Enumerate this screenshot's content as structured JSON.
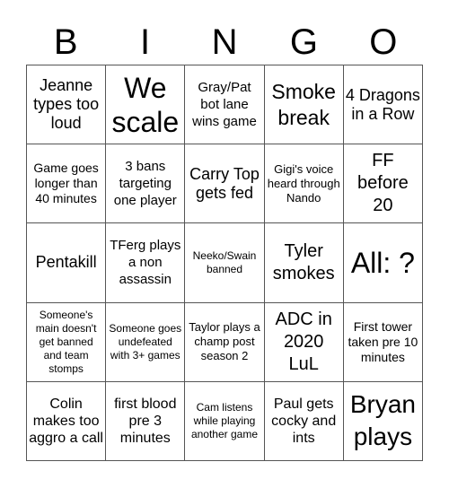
{
  "header": {
    "letters": [
      "B",
      "I",
      "N",
      "G",
      "O"
    ]
  },
  "cells": [
    [
      "Jeanne types too loud",
      "We scale",
      "Gray/Pat bot lane wins game",
      "Smoke break",
      "4 Dragons in a Row"
    ],
    [
      "Game goes longer than 40 minutes",
      "3 bans targeting one player",
      "Carry Top gets fed",
      "Gigi's voice heard through Nando",
      "FF before 20"
    ],
    [
      "Pentakill",
      "TFerg plays a non assassin",
      "Neeko/Swain banned",
      "Tyler smokes",
      "All: ?"
    ],
    [
      "Someone's main doesn't get banned and team stomps",
      "Someone goes undefeated with 3+ games",
      "Taylor plays a champ post season 2",
      "ADC in 2020 LuL",
      "First tower taken pre 10 minutes"
    ],
    [
      "Colin makes too aggro a call",
      "first blood pre 3 minutes",
      "Cam listens while playing another game",
      "Paul gets cocky and ints",
      "Bryan plays"
    ]
  ]
}
